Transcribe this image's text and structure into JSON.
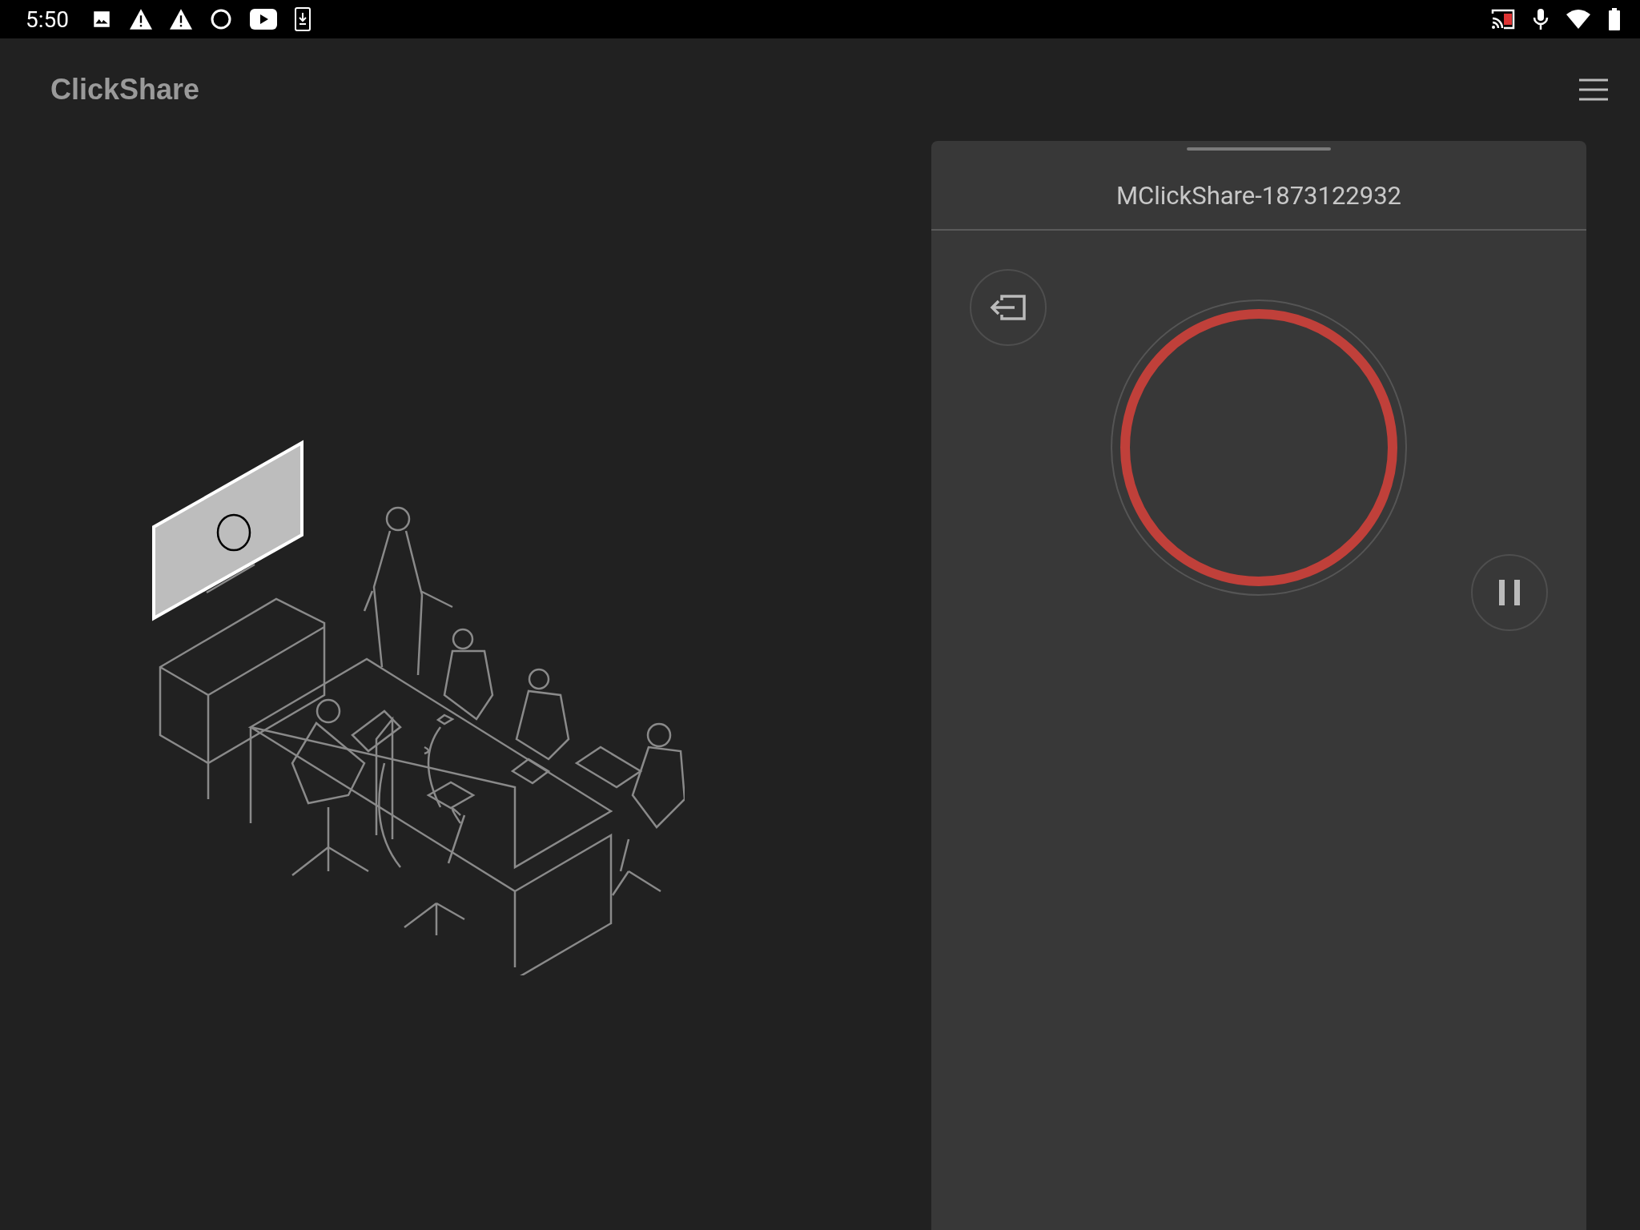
{
  "status_bar": {
    "time": "5:50"
  },
  "app_bar": {
    "title": "ClickShare"
  },
  "share_panel": {
    "device_name": "MClickShare-1873122932"
  }
}
